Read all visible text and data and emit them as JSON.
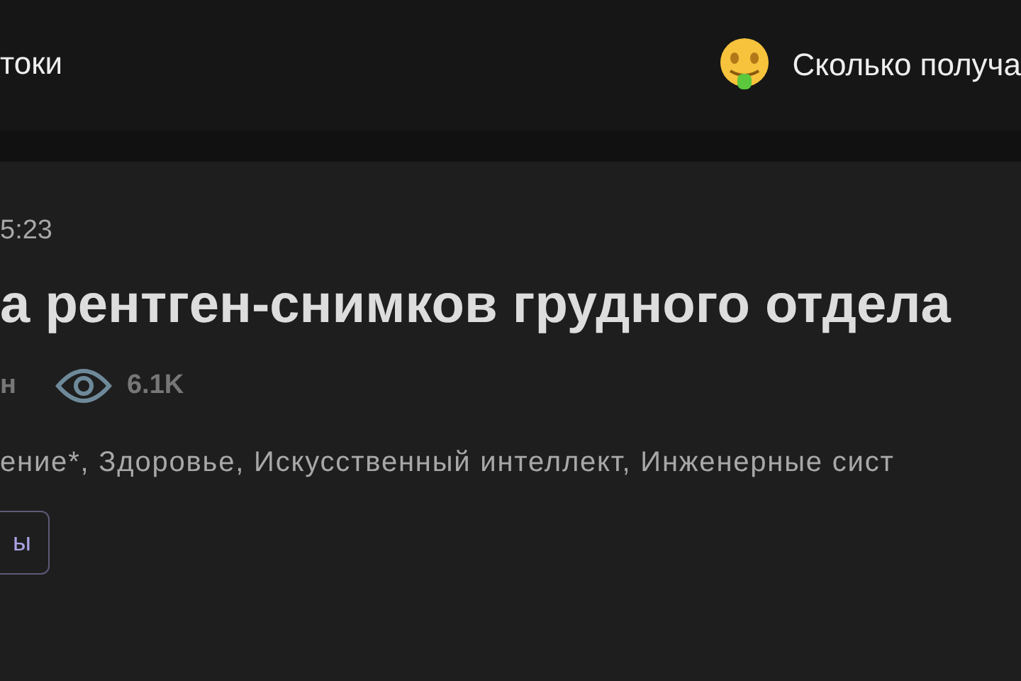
{
  "header": {
    "nav_item": "токи",
    "promo": "Сколько получа"
  },
  "article": {
    "time": "5:23",
    "title": "а рентген-снимков грудного отдела",
    "meta": {
      "reading_time": "н",
      "views": "6.1K"
    },
    "hubs": "ение*, Здоровье, Искусственный интеллект, Инженерные сист",
    "tag": "ы"
  }
}
